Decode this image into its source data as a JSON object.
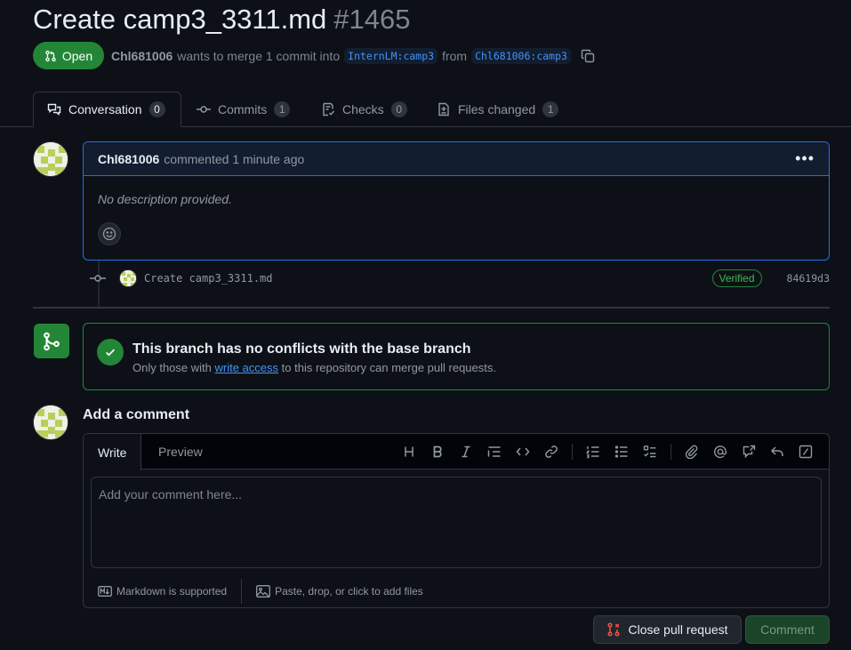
{
  "pr": {
    "title": "Create camp3_3311.md",
    "number": "#1465",
    "state": "Open",
    "author": "Chl681006",
    "action_text": "wants to merge 1 commit into",
    "base_branch": "InternLM:camp3",
    "from_text": "from",
    "head_branch": "Chl681006:camp3"
  },
  "tabs": [
    {
      "label": "Conversation",
      "count": "0"
    },
    {
      "label": "Commits",
      "count": "1"
    },
    {
      "label": "Checks",
      "count": "0"
    },
    {
      "label": "Files changed",
      "count": "1"
    }
  ],
  "comment": {
    "author": "Chl681006",
    "meta": "commented 1 minute ago",
    "body": "No description provided."
  },
  "commit": {
    "message": "Create camp3_3311.md",
    "badge": "Verified",
    "sha": "84619d3"
  },
  "merge": {
    "title": "This branch has no conflicts with the base branch",
    "desc_before": "Only those with",
    "desc_link": "write access",
    "desc_after": "to this repository can merge pull requests."
  },
  "editor": {
    "heading": "Add a comment",
    "tab_write": "Write",
    "tab_preview": "Preview",
    "placeholder": "Add your comment here...",
    "markdown_note": "Markdown is supported",
    "files_note": "Paste, drop, or click to add files"
  },
  "buttons": {
    "close": "Close pull request",
    "comment": "Comment"
  },
  "colors": {
    "background": "#0d1117",
    "accent_green": "#238636",
    "accent_blue": "#1f6feb",
    "link": "#4493f8"
  }
}
